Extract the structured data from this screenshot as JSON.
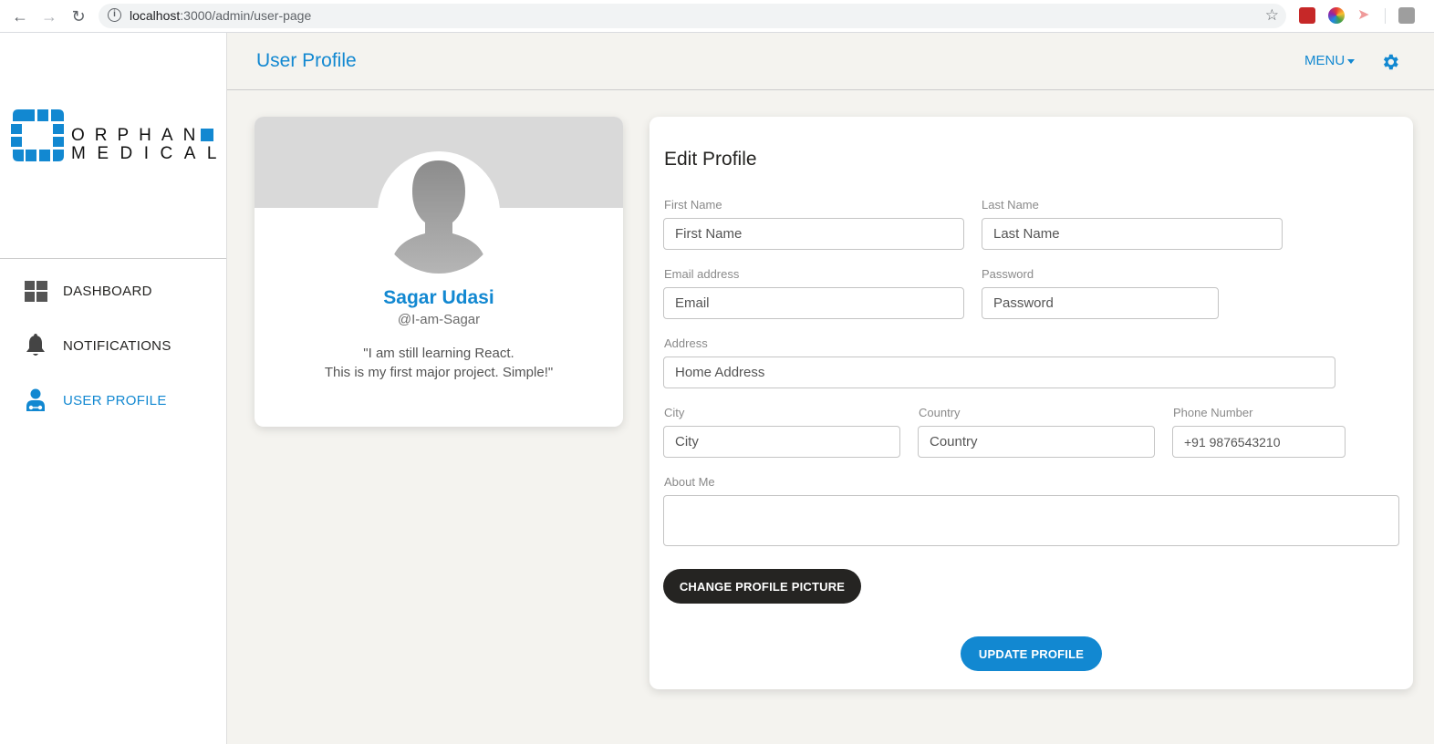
{
  "browser": {
    "url_host": "localhost",
    "url_path": ":3000/admin/user-page"
  },
  "brand": {
    "line1": "ORPHAN",
    "line2": "MEDICAL",
    "color": "#1288d1"
  },
  "sidebar": {
    "items": [
      {
        "label": "DASHBOARD",
        "icon": "dashboard-icon",
        "active": false
      },
      {
        "label": "NOTIFICATIONS",
        "icon": "bell-icon",
        "active": false
      },
      {
        "label": "USER PROFILE",
        "icon": "doctor-icon",
        "active": true
      }
    ]
  },
  "header": {
    "title": "User Profile",
    "menu_label": "MENU"
  },
  "profile": {
    "name": "Sagar Udasi",
    "handle": "@I-am-Sagar",
    "bio_line1": "\"I am still learning React.",
    "bio_line2": "This is my first major project. Simple!\""
  },
  "form": {
    "title": "Edit Profile",
    "first_name": {
      "label": "First Name",
      "placeholder": "First Name",
      "value": ""
    },
    "last_name": {
      "label": "Last Name",
      "placeholder": "Last Name",
      "value": ""
    },
    "email": {
      "label": "Email address",
      "placeholder": "Email",
      "value": ""
    },
    "password": {
      "label": "Password",
      "placeholder": "Password",
      "value": ""
    },
    "address": {
      "label": "Address",
      "placeholder": "Home Address",
      "value": ""
    },
    "city": {
      "label": "City",
      "placeholder": "City",
      "value": ""
    },
    "country": {
      "label": "Country",
      "placeholder": "Country",
      "value": ""
    },
    "phone": {
      "label": "Phone Number",
      "placeholder": "+91 9876543210",
      "value": ""
    },
    "about": {
      "label": "About Me",
      "placeholder": "",
      "value": ""
    },
    "change_picture_label": "CHANGE PROFILE PICTURE",
    "update_label": "UPDATE PROFILE"
  }
}
